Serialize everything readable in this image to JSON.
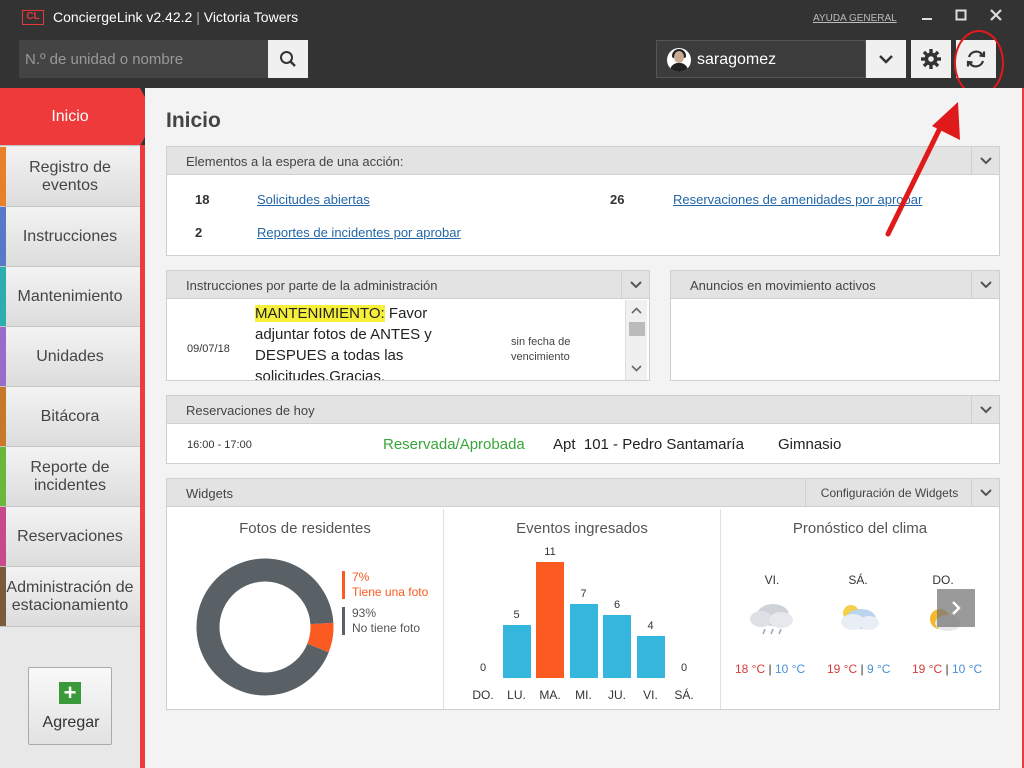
{
  "titlebar": {
    "logo": "CL",
    "app_name": "ConciergeLink v2.42.2",
    "separator": "|",
    "building": "Victoria Towers",
    "help": "AYUDA GENERAL"
  },
  "toolbar": {
    "search_placeholder": "N.º de unidad o nombre",
    "username": "saragomez"
  },
  "sidebar": {
    "items": [
      {
        "label": "Inicio",
        "color": "#ee3a3a"
      },
      {
        "label": "Registro de eventos",
        "color": "#e8802a"
      },
      {
        "label": "Instrucciones",
        "color": "#5a78c8"
      },
      {
        "label": "Mantenimiento",
        "color": "#2aaeae"
      },
      {
        "label": "Unidades",
        "color": "#9a6cc8"
      },
      {
        "label": "Bitácora",
        "color": "#c8782a"
      },
      {
        "label": "Reporte de incidentes",
        "color": "#6ab83a"
      },
      {
        "label": "Reservaciones",
        "color": "#c84a8a"
      },
      {
        "label": "Administración de estacionamiento",
        "color": "#7a5a3a"
      }
    ],
    "add_label": "Agregar"
  },
  "main": {
    "title": "Inicio",
    "pending": {
      "title": "Elementos a la espera de una acción:",
      "items": [
        {
          "count": "18",
          "label": "Solicitudes abiertas"
        },
        {
          "count": "26",
          "label": "Reservaciones de amenidades por aprobar"
        },
        {
          "count": "2",
          "label": "Reportes de incidentes por aprobar"
        }
      ]
    },
    "instructions": {
      "title": "Instrucciones por parte de la administración",
      "date": "09/07/18",
      "highlight": "MANTENIMIENTO:",
      "text_line1": " Favor",
      "text_line2": "adjuntar fotos de ANTES y",
      "text_line3": "DESPUES a todas las",
      "text_line4": "solicitudes.Gracias.",
      "due_line1": "sin fecha de",
      "due_line2": "vencimiento"
    },
    "announcements": {
      "title": "Anuncios en movimiento activos"
    },
    "reservations": {
      "title": "Reservaciones de hoy",
      "time": "16:00 - 17:00",
      "status": "Reservada/Aprobada",
      "unit": "Apt  101 - Pedro Santamaría",
      "amenity": "Gimnasio"
    },
    "widgets": {
      "title": "Widgets",
      "config": "Configuración de Widgets",
      "photos": {
        "title": "Fotos de residentes",
        "with_pct": "7%",
        "with_label": "Tiene una foto",
        "without_pct": "93%",
        "without_label": "No tiene foto",
        "with_value": 7,
        "without_value": 93
      },
      "events": {
        "title": "Eventos ingresados"
      },
      "weather": {
        "title": "Pronóstico del clima",
        "days": [
          {
            "day": "VI.",
            "hi": "18 °C",
            "lo": "10 °C"
          },
          {
            "day": "SÁ.",
            "hi": "19 °C",
            "lo": "9 °C"
          },
          {
            "day": "DO.",
            "hi": "19 °C",
            "lo": "10 °C"
          }
        ],
        "sep": "|"
      }
    }
  },
  "chart_data": {
    "type": "bar",
    "title": "Eventos ingresados",
    "categories": [
      "DO.",
      "LU.",
      "MA.",
      "MI.",
      "JU.",
      "VI.",
      "SÁ."
    ],
    "values": [
      0,
      5,
      11,
      7,
      6,
      4,
      0
    ],
    "highlight_index": 2,
    "colors": {
      "normal": "#35b6dc",
      "highlight": "#fb5a20"
    },
    "ylim": [
      0,
      11
    ]
  },
  "colors": {
    "accent": "#ee3a3a",
    "link": "#2466a8",
    "approved": "#3aa53a",
    "donut_gray": "#5a6166",
    "donut_orange": "#fb5a20"
  }
}
